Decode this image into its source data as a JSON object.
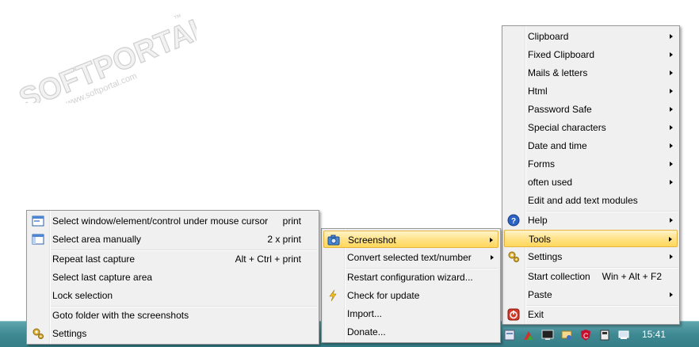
{
  "watermark": {
    "brand": "SOFTPORTAL",
    "url": "www.softportal.com",
    "tm": "™"
  },
  "taskbar": {
    "clock": "15:41"
  },
  "main_menu": {
    "items": [
      {
        "label": "Clipboard",
        "submenu": true
      },
      {
        "label": "Fixed Clipboard",
        "submenu": true
      },
      {
        "label": "Mails & letters",
        "submenu": true
      },
      {
        "label": "Html",
        "submenu": true
      },
      {
        "label": "Password Safe",
        "submenu": true
      },
      {
        "label": "Special characters",
        "submenu": true
      },
      {
        "label": "Date and time",
        "submenu": true
      },
      {
        "label": "Forms",
        "submenu": true
      },
      {
        "label": "often used",
        "submenu": true
      },
      {
        "label": "Edit and add text modules",
        "submenu": false
      },
      {
        "label": "Help",
        "submenu": true
      },
      {
        "label": "Tools",
        "submenu": true,
        "highlighted": true
      },
      {
        "label": "Settings",
        "submenu": true
      },
      {
        "label": "Start collection",
        "shortcut": "Win + Alt + F2"
      },
      {
        "label": "Paste",
        "submenu": true
      },
      {
        "label": "Exit"
      }
    ]
  },
  "tools_menu": {
    "items": [
      {
        "label": "Screenshot",
        "submenu": true,
        "highlighted": true
      },
      {
        "label": "Convert selected text/number",
        "submenu": true
      },
      {
        "label": "Restart configuration wizard..."
      },
      {
        "label": "Check for update"
      },
      {
        "label": "Import..."
      },
      {
        "label": "Donate..."
      }
    ]
  },
  "screenshot_menu": {
    "items": [
      {
        "label": "Select window/element/control under mouse cursor",
        "shortcut": "print"
      },
      {
        "label": "Select area manually",
        "shortcut": "2 x print"
      },
      {
        "label": "Repeat last capture",
        "shortcut": "Alt + Ctrl + print"
      },
      {
        "label": "Select last capture area"
      },
      {
        "label": "Lock selection"
      },
      {
        "label": "Goto folder with the screenshots"
      },
      {
        "label": "Settings"
      }
    ]
  }
}
